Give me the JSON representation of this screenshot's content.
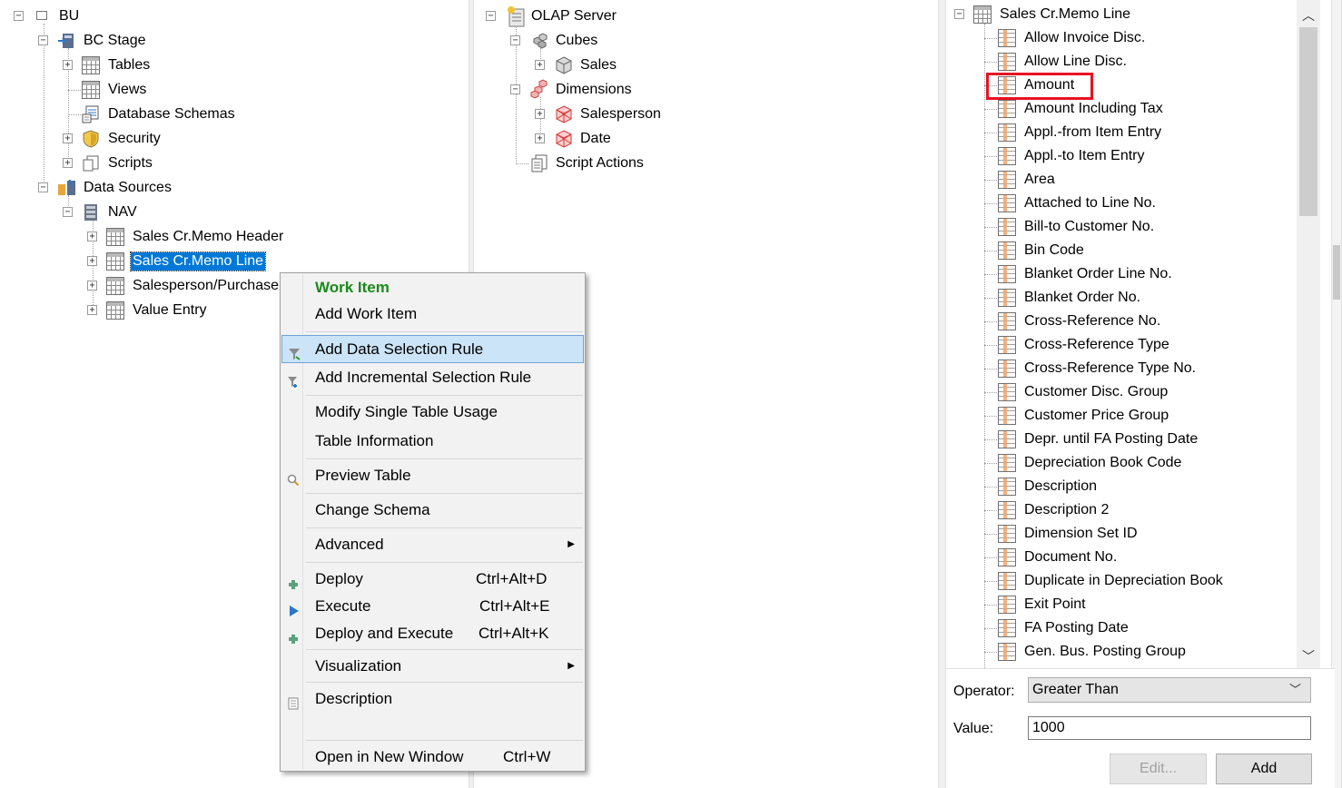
{
  "left_tree": {
    "root": "BU",
    "bc_stage": "BC Stage",
    "tables": "Tables",
    "views": "Views",
    "database_schemas": "Database Schemas",
    "security": "Security",
    "scripts": "Scripts",
    "data_sources": "Data Sources",
    "nav": "NAV",
    "nav_tables": [
      "Sales Cr.Memo Header",
      "Sales Cr.Memo Line",
      "Salesperson/Purchaser",
      "Value Entry"
    ]
  },
  "mid_tree": {
    "root": "OLAP Server",
    "cubes": "Cubes",
    "sales": "Sales",
    "dimensions": "Dimensions",
    "salesperson": "Salesperson",
    "date": "Date",
    "script_actions": "Script Actions"
  },
  "right_tree": {
    "table": "Sales Cr.Memo Line",
    "fields": [
      "Allow Invoice Disc.",
      "Allow Line Disc.",
      "Amount",
      "Amount Including Tax",
      "Appl.-from Item Entry",
      "Appl.-to Item Entry",
      "Area",
      "Attached to Line No.",
      "Bill-to Customer No.",
      "Bin Code",
      "Blanket Order Line No.",
      "Blanket Order No.",
      "Cross-Reference No.",
      "Cross-Reference Type",
      "Cross-Reference Type No.",
      "Customer Disc. Group",
      "Customer Price Group",
      "Depr. until FA Posting Date",
      "Depreciation Book Code",
      "Description",
      "Description 2",
      "Dimension Set ID",
      "Document No.",
      "Duplicate in Depreciation Book",
      "Exit Point",
      "FA Posting Date",
      "Gen. Bus. Posting Group"
    ]
  },
  "form": {
    "operator_label": "Operator:",
    "operator_value": "Greater Than",
    "value_label": "Value:",
    "value": "1000",
    "edit_button": "Edit...",
    "add_button": "Add"
  },
  "context_menu": {
    "header": "Work Item",
    "add_work_item": "Add Work Item",
    "add_data_selection_rule": "Add Data Selection Rule",
    "add_incremental_selection_rule": "Add Incremental Selection Rule",
    "modify_single_table_usage": "Modify Single Table Usage",
    "table_information": "Table Information",
    "preview_table": "Preview Table",
    "change_schema": "Change Schema",
    "advanced": "Advanced",
    "deploy": "Deploy",
    "deploy_shortcut": "Ctrl+Alt+D",
    "execute": "Execute",
    "execute_shortcut": "Ctrl+Alt+E",
    "deploy_and_execute": "Deploy and Execute",
    "deploy_and_execute_shortcut": "Ctrl+Alt+K",
    "visualization": "Visualization",
    "description": "Description",
    "open_in_new_window": "Open in New Window",
    "open_in_new_window_shortcut": "Ctrl+W"
  },
  "colors": {
    "selection": "#0078d7",
    "menu_highlight": "#cce4f7",
    "menu_header": "#1a8a1a",
    "highlight_box": "#e81123"
  }
}
